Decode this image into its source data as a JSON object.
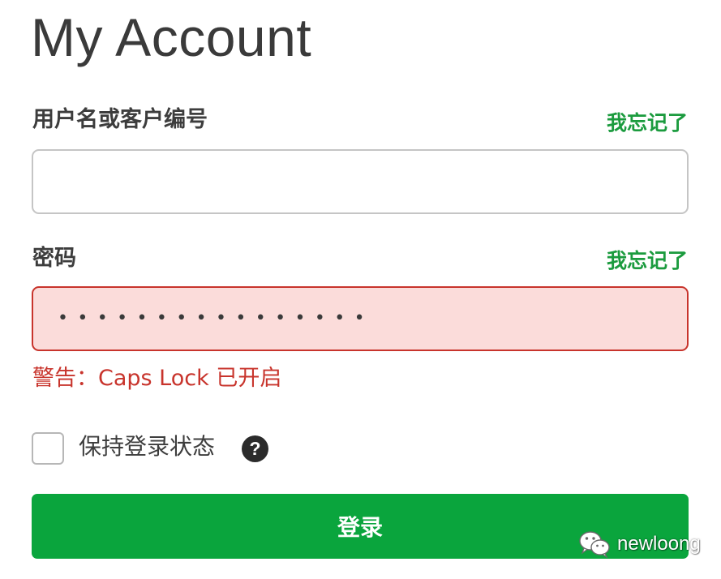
{
  "page": {
    "title": "My Account"
  },
  "username": {
    "label": "用户名或客户编号",
    "forgot_link": "我忘记了",
    "value": ""
  },
  "password": {
    "label": "密码",
    "forgot_link": "我忘记了",
    "masked_value": "••••••••••••••••",
    "warning": "警告：Caps Lock 已开启"
  },
  "remember": {
    "label": "保持登录状态",
    "checked": false,
    "help_icon": "?"
  },
  "login_button": {
    "label": "登录"
  },
  "watermark": {
    "icon": "wechat-icon",
    "text": "newloong"
  },
  "colors": {
    "accent_green": "#0aa53d",
    "link_green": "#1b9b3e",
    "error_red": "#c8342c",
    "error_bg": "#fbdcda"
  }
}
